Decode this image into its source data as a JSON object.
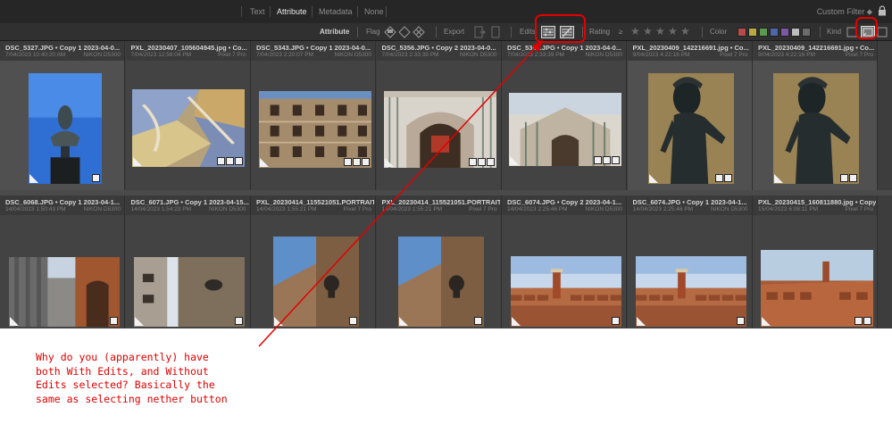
{
  "tabs": [
    "Text",
    "Attribute",
    "Metadata",
    "None"
  ],
  "active_tab": "Attribute",
  "custom_filter": "Custom Filter ⬥",
  "attribute_bar": {
    "title": "Attribute",
    "flag": "Flag",
    "export": "Export",
    "edits": "Edits",
    "rating": "Rating",
    "rating_op": "≥",
    "color": "Color",
    "kind": "Kind"
  },
  "color_labels": [
    "#b84a4a",
    "#b8a943",
    "#5c9b4d",
    "#4d67a8",
    "#7b58a3",
    "#bdbdbd",
    "#6b6b6b"
  ],
  "photos_row1": [
    {
      "name": "DSC_5327.JPG • Copy 1    2023-04-0...",
      "date": "7/04/2023 10:40:20 AM",
      "camera": "NIKON D5300",
      "stars": "★★★★ ·"
    },
    {
      "name": "PXL_20230407_105604945.jpg • Co...",
      "date": "7/04/2023 12:56:04 PM",
      "camera": "Pixel 7 Pro",
      "stars": "· · · · ·"
    },
    {
      "name": "DSC_5343.JPG • Copy 1    2023-04-0...",
      "date": "7/04/2023 2:20:07 PM",
      "camera": "NIKON D5300",
      "stars": "· · · · ·"
    },
    {
      "name": "DSC_5356.JPG • Copy 2    2023-04-0...",
      "date": "7/04/2023 2:33:39 PM",
      "camera": "NIKON D5300",
      "stars": "· · · · ·"
    },
    {
      "name": "DSC_5356.JPG • Copy 1    2023-04-0...",
      "date": "7/04/2023 2:33:39 PM",
      "camera": "NIKON D5300",
      "stars": "· · · · ·"
    },
    {
      "name": "PXL_20230409_142216691.jpg • Co...",
      "date": "9/04/2023 4:22:16 PM",
      "camera": "Pixel 7 Pro",
      "stars": "★★★★ ·"
    },
    {
      "name": "PXL_20230409_142216691.jpg • Co...",
      "date": "9/04/2023 4:22:16 PM",
      "camera": "Pixel 7 Pro",
      "stars": "★★★★ ·"
    }
  ],
  "photos_row2": [
    {
      "name": "DSC_6068.JPG • Copy 1    2023-04-1...",
      "date": "14/04/2023 1:50:43 PM",
      "camera": "NIKON D5300"
    },
    {
      "name": "DSC_6071.JPG • Copy 1    2023-04-15...",
      "date": "14/04/2023 1:54:23 PM",
      "camera": "NIKON D5300"
    },
    {
      "name": "PXL_20230414_115521051.PORTRAIT....",
      "date": "14/04/2023 1:55:21 PM",
      "camera": "Pixel 7 Pro"
    },
    {
      "name": "PXL_20230414_115521051.PORTRAIT....",
      "date": "14/04/2023 1:55:21 PM",
      "camera": "Pixel 7 Pro"
    },
    {
      "name": "DSC_6074.JPG • Copy 2    2023-04-1...",
      "date": "14/04/2023 2:25:46 PM",
      "camera": "NIKON D5300"
    },
    {
      "name": "DSC_6074.JPG • Copy 1    2023-04-1...",
      "date": "14/04/2023 2:25:46 PM",
      "camera": "NIKON D5300"
    },
    {
      "name": "PXL_20230415_160811880.jpg • Copy 1",
      "date": "15/04/2023 6:08:11 PM",
      "camera": "Pixel 7 Pro"
    }
  ],
  "annotation_text": "Why do you (apparently) have\nboth With Edits, and Without\nEdits selected? Basically the\nsame as selecting nether button",
  "annotation_color": "#e30000"
}
